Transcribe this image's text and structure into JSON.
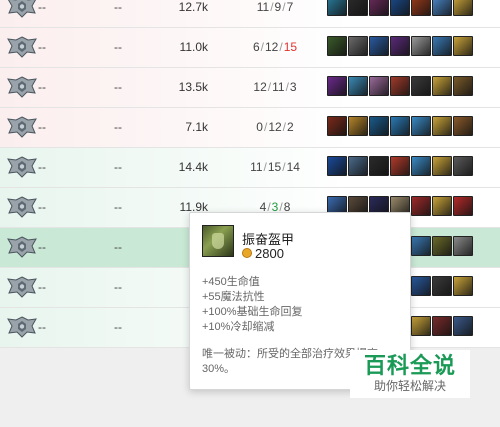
{
  "colors": {
    "positive": "#1f9b3f",
    "negative": "#e0332f",
    "row_highlight": "#c9e9d6",
    "watermark": "#1a9a56"
  },
  "rows": [
    {
      "rank_icon": "rank-emblem-icon",
      "c1": "--",
      "c2": "--",
      "gold": "12.7k",
      "kills": "11",
      "deaths": "9",
      "assists": "7",
      "deaths_state": "",
      "kills_state": "",
      "bg": "red",
      "items": [
        "#2a7a9a",
        "#2b2b2b",
        "#6a2a5a",
        "#1a4a8a",
        "#9a3a1a",
        "#4a86c9",
        "#c9a33a"
      ]
    },
    {
      "rank_icon": "rank-emblem-icon",
      "c1": "--",
      "c2": "--",
      "gold": "11.0k",
      "kills": "6",
      "deaths": "12",
      "assists": "15",
      "deaths_state": "",
      "kills_state": "",
      "assists_state": "bad",
      "bg": "red",
      "items": [
        "#3a5a2a",
        "#6a6a6a",
        "#2a5aa0",
        "#5a2a7a",
        "#9a9a9a",
        "#3a7ab5",
        "#c9a33a"
      ]
    },
    {
      "rank_icon": "rank-emblem-icon",
      "c1": "--",
      "c2": "--",
      "gold": "13.5k",
      "kills": "12",
      "deaths": "11",
      "assists": "3",
      "deaths_state": "",
      "kills_state": "",
      "bg": "red",
      "items": [
        "#6a2a8a",
        "#3a8ab5",
        "#9a6a9a",
        "#a03a2a",
        "#3a3a3a",
        "#c9a33a",
        "#7a5a2a"
      ]
    },
    {
      "rank_icon": "rank-emblem-icon",
      "c1": "--",
      "c2": "--",
      "gold": "7.1k",
      "kills": "0",
      "deaths": "12",
      "assists": "2",
      "deaths_state": "",
      "kills_state": "",
      "bg": "red",
      "items": [
        "#7a2a1a",
        "#b5852a",
        "#1a5a8a",
        "#2a7ab5",
        "#3a8ac5",
        "#c9a33a",
        "#8a5a2a"
      ]
    },
    {
      "rank_icon": "rank-emblem-icon",
      "c1": "--",
      "c2": "--",
      "gold": "14.4k",
      "kills": "11",
      "deaths": "15",
      "assists": "14",
      "deaths_state": "",
      "kills_state": "",
      "bg": "green",
      "items": [
        "#1a4a9a",
        "#4a6a8a",
        "#2a2a2a",
        "#b03a2a",
        "#3a8ac5",
        "#c9a33a",
        "#5a5a5a"
      ]
    },
    {
      "rank_icon": "rank-emblem-icon",
      "c1": "--",
      "c2": "--",
      "gold": "11.9k",
      "kills": "4",
      "deaths": "3",
      "assists": "8",
      "deaths_state": "good",
      "kills_state": "",
      "bg": "green",
      "items": [
        "#3a6ab0",
        "#5a4a3a",
        "#2a2a5a",
        "#9a8a6a",
        "#a02a2a",
        "#c9a33a",
        "#b52a2a"
      ]
    },
    {
      "rank_icon": "rank-emblem-icon",
      "c1": "--",
      "c2": "--",
      "gold": "",
      "kills": "",
      "deaths": "",
      "assists": "",
      "deaths_state": "",
      "kills_state": "",
      "bg": "hl",
      "items": [
        "#4a6a2a",
        "#5a5a5a",
        "#3a3a3a",
        "#c9a33a",
        "#3a7ab5",
        "#6a6a2a",
        "#8a8a8a"
      ]
    },
    {
      "rank_icon": "rank-emblem-icon",
      "c1": "--",
      "c2": "--",
      "gold": "",
      "kills": "",
      "deaths": "",
      "assists": "",
      "deaths_state": "",
      "kills_state": "",
      "bg": "green",
      "items": [
        "#2a5a8a",
        "#7a7a9a",
        "#5a3a2a",
        "#9a9aaa",
        "#2a5aa0",
        "#3a3a3a",
        "#c9a33a"
      ]
    },
    {
      "rank_icon": "rank-emblem-icon",
      "c1": "--",
      "c2": "--",
      "gold": "",
      "kills": "",
      "deaths": "",
      "assists": "",
      "deaths_state": "",
      "kills_state": "",
      "bg": "green",
      "items": [
        "#8a2a3a",
        "#3a3a3a",
        "#a02a5a",
        "#2a2a2a",
        "#c9a33a",
        "#7a2a2a",
        "#3a5a8a"
      ]
    }
  ],
  "tooltip": {
    "icon": "warmog-armor-icon",
    "name": "振奋盔甲",
    "price": "2800",
    "stats": [
      "+450生命值",
      "+55魔法抗性",
      "+100%基础生命回复",
      "+10%冷却缩减"
    ],
    "description": "唯一被动：所受的全部治疗效果提高30%。"
  },
  "watermark": {
    "title": "百科全说",
    "subtitle": "助你轻松解决"
  }
}
